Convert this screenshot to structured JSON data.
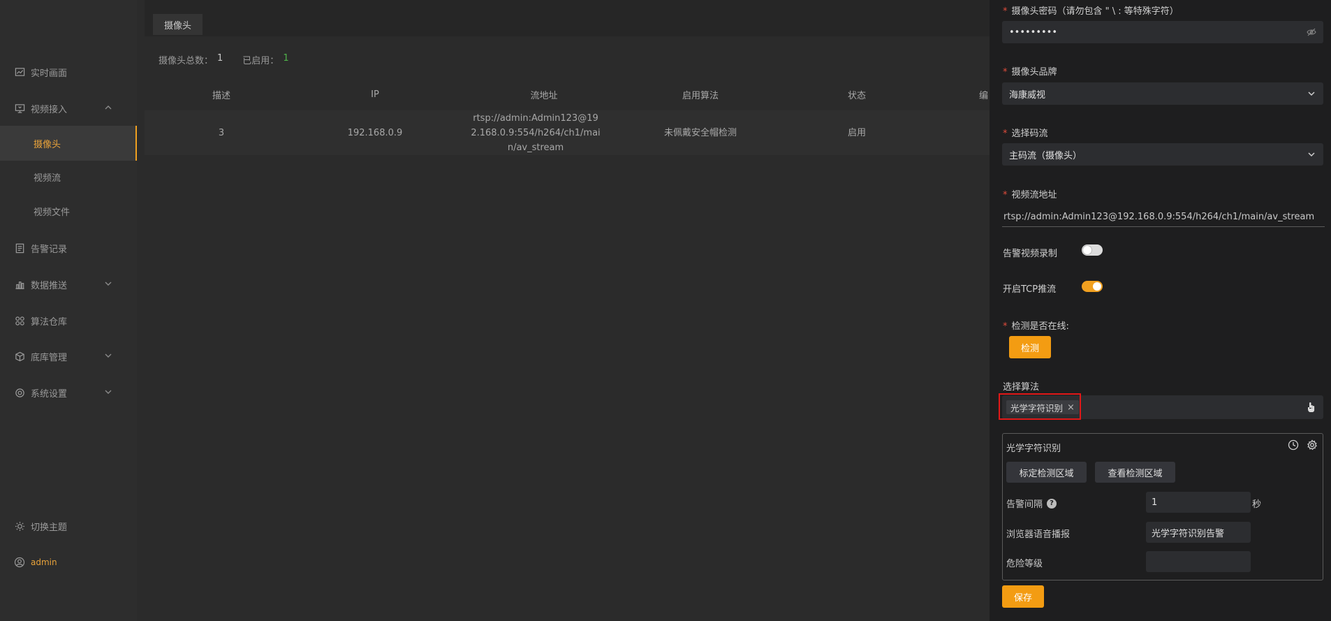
{
  "sidebar": {
    "items": [
      {
        "label": "实时画面"
      },
      {
        "label": "视频接入"
      },
      {
        "label": "摄像头"
      },
      {
        "label": "视频流"
      },
      {
        "label": "视频文件"
      },
      {
        "label": "告警记录"
      },
      {
        "label": "数据推送"
      },
      {
        "label": "算法仓库"
      },
      {
        "label": "底库管理"
      },
      {
        "label": "系统设置"
      }
    ],
    "theme_label": "切换主题",
    "user_name": "admin"
  },
  "main": {
    "tab_label": "摄像头",
    "stats": {
      "total_label": "摄像头总数：",
      "total_value": "1",
      "enabled_label": "已启用：",
      "enabled_value": "1"
    },
    "table": {
      "headers": [
        "描述",
        "IP",
        "流地址",
        "启用算法",
        "状态",
        "编"
      ],
      "rows": [
        {
          "desc": "3",
          "ip": "192.168.0.9",
          "url": "rtsp://admin:Admin123@192.168.0.9:554/h264/ch1/main/av_stream",
          "algo": "未佩戴安全帽检测",
          "status": "启用"
        }
      ]
    }
  },
  "panel": {
    "password_label": "摄像头密码（请勿包含 \" \\ : 等特殊字符）",
    "password_value": "•••••••••",
    "brand_label": "摄像头品牌",
    "brand_value": "海康威视",
    "stream_label": "选择码流",
    "stream_value": "主码流（摄像头）",
    "url_label": "视频流地址",
    "url_value": "rtsp://admin:Admin123@192.168.0.9:554/h264/ch1/main/av_stream",
    "record_label": "告警视频录制",
    "record_on": false,
    "tcp_label": "开启TCP推流",
    "tcp_on": true,
    "online_label": "检测是否在线:",
    "detect_button": "检测",
    "algo_label": "选择算法",
    "algo_tag": "光学字符识别",
    "algo_box": {
      "title": "光学字符识别",
      "mark_region_button": "标定检测区域",
      "view_region_button": "查看检测区域",
      "interval_label": "告警间隔",
      "interval_value": "1",
      "interval_unit": "秒",
      "voice_label": "浏览器语音播报",
      "voice_value": "光学字符识别告警",
      "danger_label": "危险等级",
      "danger_value": ""
    },
    "save_button": "保存"
  },
  "colors": {
    "accent": "#f39c12",
    "highlight": "#e01818",
    "enabled_green": "#4fb34a"
  }
}
